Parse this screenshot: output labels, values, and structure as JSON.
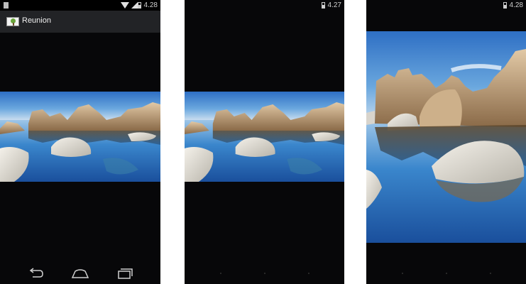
{
  "screens": [
    {
      "status_time": "4.28",
      "app_title": "Reunion",
      "nav": [
        "back-icon",
        "home-icon",
        "recent-apps-icon"
      ]
    },
    {
      "status_time": "4.27"
    },
    {
      "status_time": "4.28"
    }
  ],
  "colors": {
    "phone_background": "#070709",
    "action_bar": "#222326",
    "sky": "#3f86d0",
    "water": "#1f5fae"
  }
}
